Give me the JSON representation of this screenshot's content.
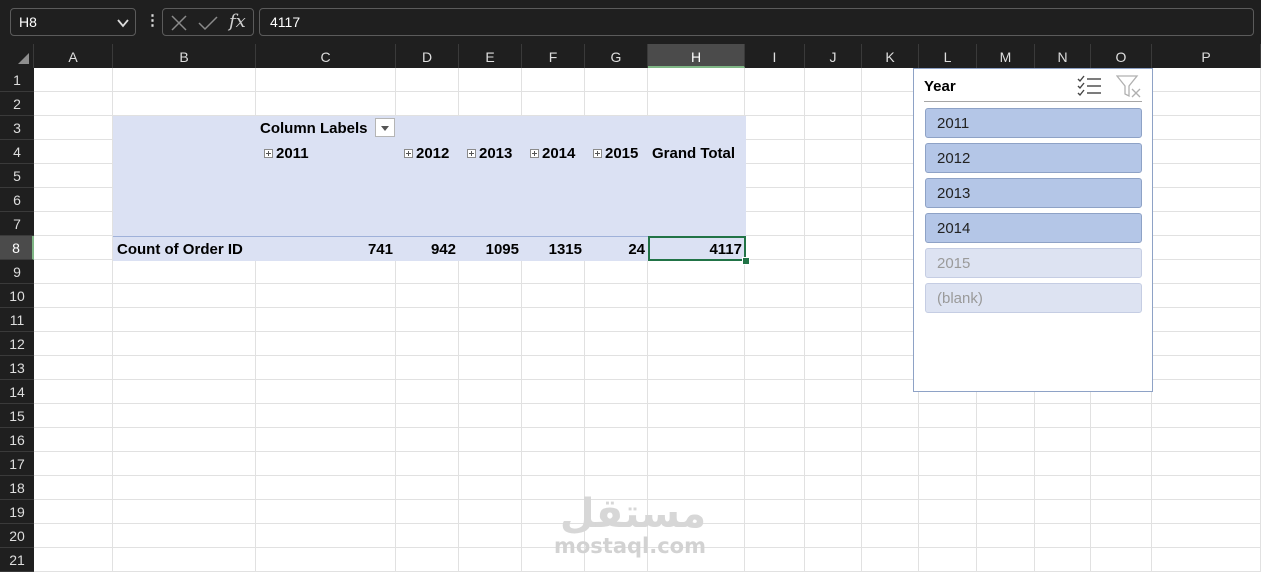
{
  "formula_bar": {
    "name_box": "H8",
    "formula": "4117",
    "fx_label": "fx",
    "icons": {
      "cancel": "x-icon",
      "enter": "check-icon",
      "more": "dots-icon",
      "dropdown": "chevron-down-icon"
    }
  },
  "columns": [
    "A",
    "B",
    "C",
    "D",
    "E",
    "F",
    "G",
    "H",
    "I",
    "J",
    "K",
    "L",
    "M",
    "N",
    "O",
    "P"
  ],
  "rows": [
    "1",
    "2",
    "3",
    "4",
    "5",
    "6",
    "7",
    "8",
    "9",
    "10",
    "11",
    "12",
    "13",
    "14",
    "15",
    "16",
    "17",
    "18",
    "19",
    "20",
    "21"
  ],
  "selected_cell": {
    "column": "H",
    "row": "8"
  },
  "pivot": {
    "column_labels": "Column Labels",
    "years": [
      "2011",
      "2012",
      "2013",
      "2014",
      "2015"
    ],
    "grand_total_label": "Grand Total",
    "row_label": "Count of Order ID",
    "values": [
      "741",
      "942",
      "1095",
      "1315",
      "24"
    ],
    "grand_total": "4117",
    "fill_color": "#dbe1f3"
  },
  "slicer": {
    "title": "Year",
    "items": [
      {
        "label": "2011",
        "selected": true
      },
      {
        "label": "2012",
        "selected": true
      },
      {
        "label": "2013",
        "selected": true
      },
      {
        "label": "2014",
        "selected": true
      },
      {
        "label": "2015",
        "selected": false
      },
      {
        "label": "(blank)",
        "selected": false
      }
    ],
    "icons": {
      "multi_select": "multi-select-icon",
      "clear_filter": "clear-filter-icon"
    },
    "selected_color": "#b4c6e7"
  },
  "watermark": {
    "arabic": "مستقل",
    "latin": "mostaql.com"
  },
  "colors": {
    "chrome": "#1f1f1f",
    "selection": "#217346",
    "gridline": "#e1e1e1"
  }
}
